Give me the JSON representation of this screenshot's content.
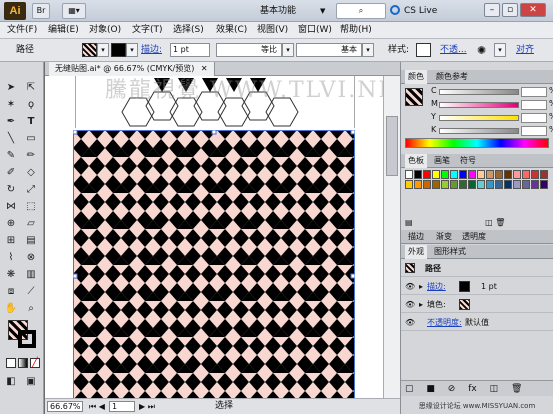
{
  "app": {
    "logo": "Ai",
    "workspace": "基本功能",
    "cslive": "CS Live",
    "window_controls": [
      "minimize",
      "maximize",
      "close"
    ]
  },
  "menu": [
    "文件(F)",
    "编辑(E)",
    "对象(O)",
    "文字(T)",
    "选择(S)",
    "效果(C)",
    "视图(V)",
    "窗口(W)",
    "帮助(H)"
  ],
  "control": {
    "selection_type": "路径",
    "stroke_label": "描边:",
    "stroke_weight": "1 pt",
    "profile_label": "等比",
    "brush_label": "基本",
    "style_label": "样式:",
    "opacity_label": "不透...",
    "align_label": "对齐"
  },
  "document": {
    "tab_title": "无缝贴图.ai* @ 66.67% (CMYK/预览)",
    "zoom": "66.67%",
    "page": "1",
    "status_tool": "选择",
    "watermark": "騰龍視覺 WWW.TLVI.NET"
  },
  "color_panel": {
    "tabs": [
      "颜色",
      "颜色参考"
    ],
    "channels": [
      {
        "name": "C",
        "value": "%"
      },
      {
        "name": "M",
        "value": "%"
      },
      {
        "name": "Y",
        "value": "%"
      },
      {
        "name": "K",
        "value": "%"
      }
    ]
  },
  "swatch_panel": {
    "tabs": [
      "色板",
      "画笔",
      "符号"
    ],
    "colors": [
      "#ffffff",
      "#000000",
      "#ff0000",
      "#ffff00",
      "#00ff00",
      "#00ffff",
      "#0000ff",
      "#ff00ff",
      "#ffcc99",
      "#cc9966",
      "#996633",
      "#663300",
      "#ff9999",
      "#ff6666",
      "#cc3333",
      "#993333",
      "#ffcc00",
      "#ff9900",
      "#cc6600",
      "#996600",
      "#99cc33",
      "#669933",
      "#336633",
      "#006633",
      "#66cccc",
      "#3399cc",
      "#336699",
      "#003366",
      "#9999cc",
      "#666699",
      "#663399",
      "#330066"
    ]
  },
  "stroke_panel": {
    "tabs": [
      "描边",
      "渐变",
      "透明度"
    ]
  },
  "appearance_panel": {
    "tabs": [
      "外观",
      "图形样式"
    ],
    "title": "路径",
    "rows": [
      {
        "label": "描边:",
        "value": "1 pt"
      },
      {
        "label": "填色:",
        "value": ""
      },
      {
        "label": "不透明度:",
        "value": "默认值"
      }
    ]
  },
  "colors": {
    "pattern_bg": "#f8d7d0",
    "pattern_fg": "#000000",
    "canvas_gray": "#6e6e6e"
  },
  "footer_watermark": "思缘设计论坛 www.MISSYUAN.com"
}
